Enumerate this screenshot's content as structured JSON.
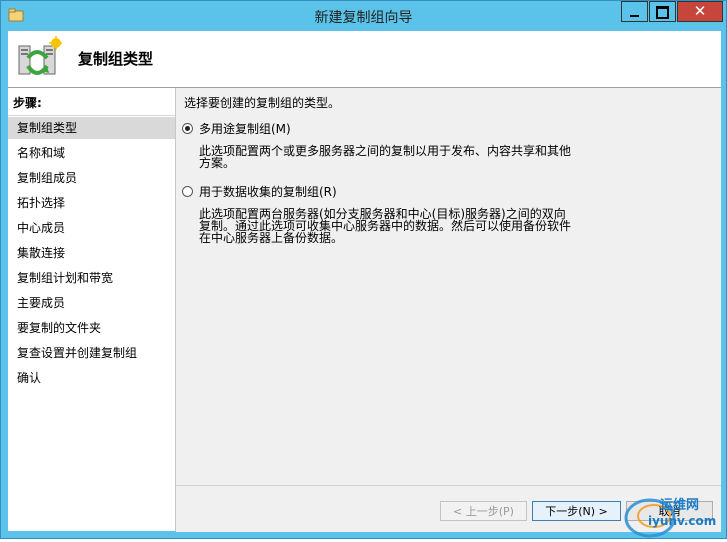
{
  "window": {
    "title": "新建复制组向导",
    "controls": {
      "minimize": "minimize-icon",
      "maximize": "maximize-icon",
      "close": "✕"
    }
  },
  "header": {
    "title": "复制组类型",
    "icon": "replication-servers-icon"
  },
  "steps": {
    "label": "步骤:",
    "items": [
      "复制组类型",
      "名称和域",
      "复制组成员",
      "拓扑选择",
      "中心成员",
      "集散连接",
      "复制组计划和带宽",
      "主要成员",
      "要复制的文件夹",
      "复查设置并创建复制组",
      "确认"
    ],
    "active_index": 0
  },
  "main": {
    "intro": "选择要创建的复制组的类型。",
    "options": [
      {
        "label": "多用途复制组(M)",
        "checked": true,
        "desc_lines": [
          "此选项配置两个或更多服务器之间的复制以用于发布、内容共享和其他",
          "方案。"
        ]
      },
      {
        "label": "用于数据收集的复制组(R)",
        "checked": false,
        "desc_lines": [
          "此选项配置两台服务器(如分支服务器和中心(目标)服务器)之间的双向",
          "复制。通过此选项可收集中心服务器中的数据。然后可以使用备份软件",
          "在中心服务器上备份数据。"
        ]
      }
    ]
  },
  "footer": {
    "prev": "< 上一步(P)",
    "next": "下一步(N) >",
    "cancel": "取消"
  },
  "watermark": {
    "line1": "运维网",
    "line2": "iyunv.com"
  },
  "colors": {
    "titlebar": "#5bc3ea",
    "close": "#c7463b",
    "panel": "#f0f0f0",
    "active_step": "#d9d9d9"
  }
}
